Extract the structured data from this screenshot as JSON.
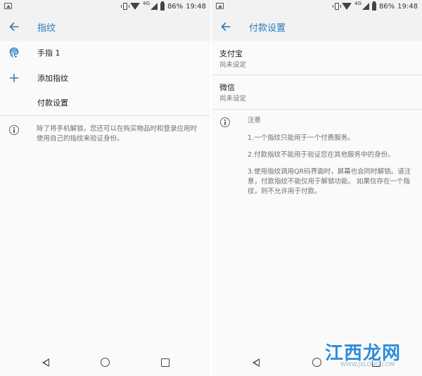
{
  "status_bar": {
    "network": "4G",
    "battery": "86%",
    "time": "19:48"
  },
  "left": {
    "title": "指纹",
    "items": [
      {
        "icon": "fingerprint-icon",
        "label": "手指 1"
      },
      {
        "icon": "plus-icon",
        "label": "添加指纹"
      },
      {
        "icon": "",
        "label": "付款设置"
      }
    ],
    "info_text": "除了将手机解锁，您还可以在购买物品时和登录应用时使用自己的指纹来验证身份。"
  },
  "right": {
    "title": "付款设置",
    "payments": [
      {
        "name": "支付宝",
        "status": "尚未设定"
      },
      {
        "name": "微信",
        "status": "尚未设定"
      }
    ],
    "notice_title": "注意",
    "notices": [
      "1.一个指纹只能用于一个付费服务。",
      "2.付款指纹不能用于验证您在其他服务中的身份。",
      "3.使用指纹调用QR码界面时，屏幕也会同时解锁。请注意，付款指纹不能仅用于解锁功能。 如果仅存在一个指纹，则不允许用于付款。"
    ]
  },
  "watermark": {
    "text": "江西龙网",
    "small": "WWW.JXLONG.COM"
  },
  "colors": {
    "accent": "#2a79b8",
    "background": "#fafafa",
    "bar": "#f2f2f2"
  }
}
